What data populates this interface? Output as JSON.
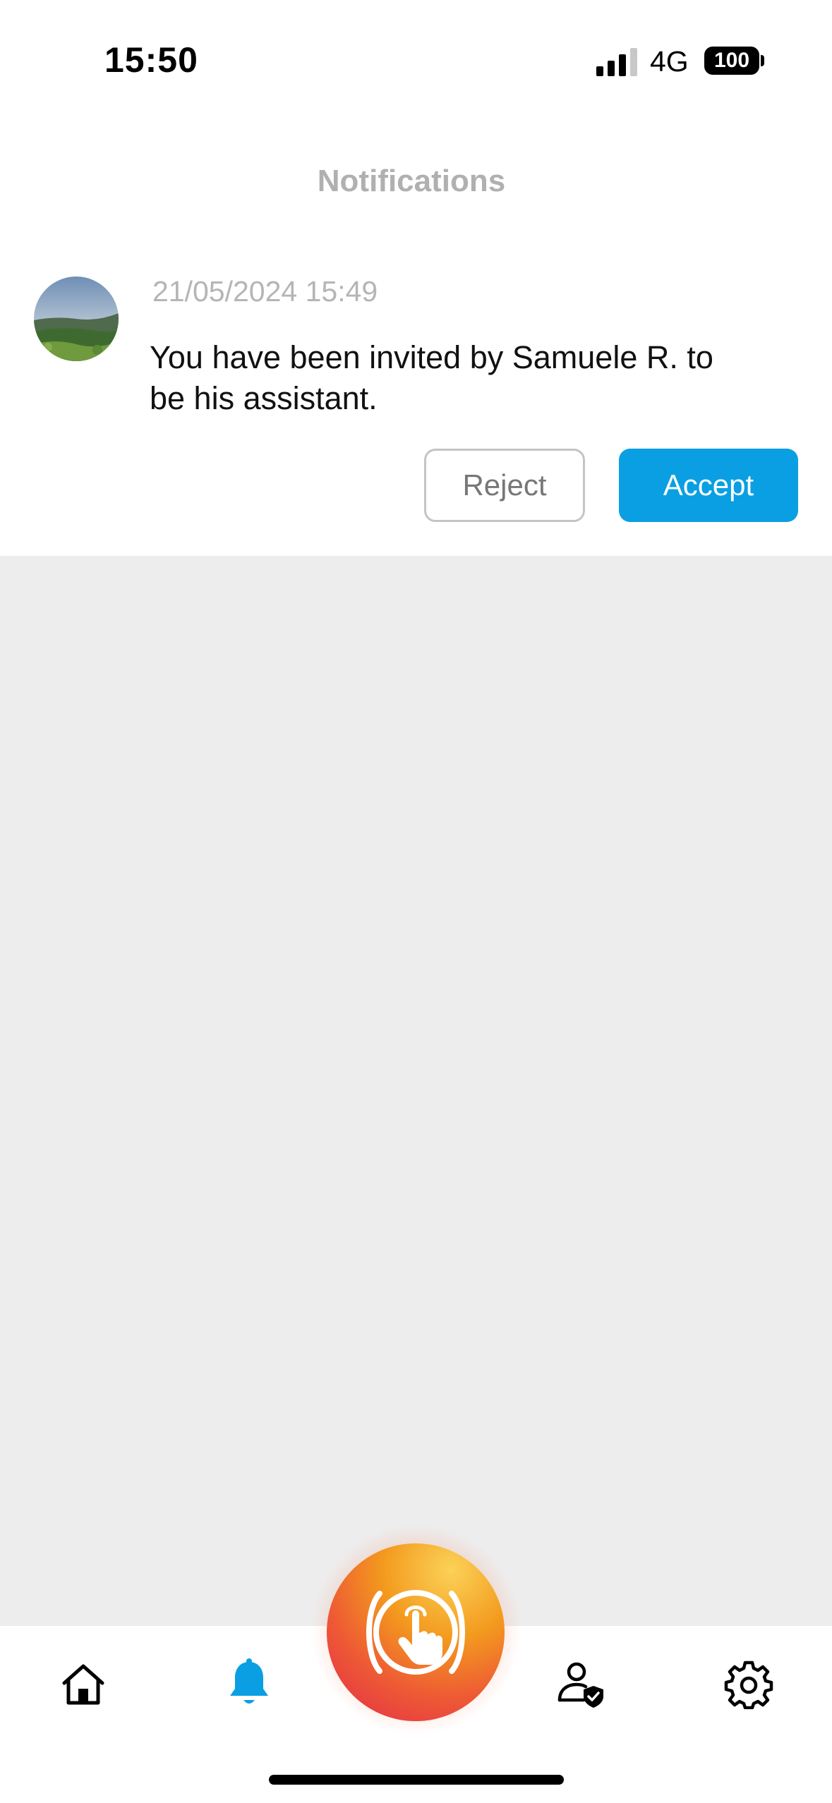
{
  "status_bar": {
    "time": "15:50",
    "network": "4G",
    "battery": "100"
  },
  "header": {
    "title": "Notifications"
  },
  "notification": {
    "date": "21/05/2024 15:49",
    "message": "You have been invited by Samuele R. to be his assistant.",
    "reject_label": "Reject",
    "accept_label": "Accept"
  },
  "tab_bar": {
    "tabs": [
      {
        "icon": "home-icon",
        "active": false
      },
      {
        "icon": "bell-icon",
        "active": true
      },
      {
        "icon": "sos-hand-tap-icon",
        "active": false
      },
      {
        "icon": "user-shield-icon",
        "active": false
      },
      {
        "icon": "gear-icon",
        "active": false
      }
    ]
  },
  "colors": {
    "accent": "#0a9fe3",
    "title_gray": "#b0b0b0",
    "content_background": "#ededed",
    "sos_gradient": [
      "#fbd257",
      "#f39a1e",
      "#ee5a34",
      "#e2294b"
    ]
  }
}
